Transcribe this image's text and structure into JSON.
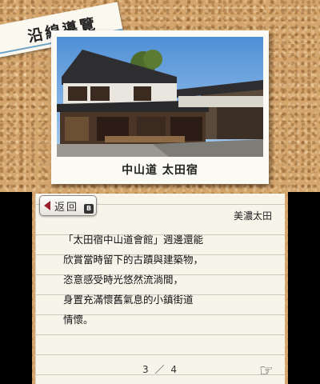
{
  "top": {
    "banner_title": "沿線導覽",
    "photo_caption": "中山道 太田宿"
  },
  "bottom": {
    "back_button": {
      "label": "返回",
      "key_hint": "B"
    },
    "location": "美濃太田",
    "lines": [
      "「太田宿中山道會館」週邊還能",
      "欣賞當時留下的古蹟與建築物，",
      "恣意感受時光悠然流淌間，",
      "身置充滿懷舊氣息的小鎮街道",
      "情懷。"
    ],
    "page": {
      "current": "3",
      "separator": "／",
      "total": "4"
    },
    "next_icon": "pointing-hand-icon"
  },
  "colors": {
    "cork": "#d4a56c",
    "paper": "#f7f4ea",
    "banner_stripe": "#6fa3c6",
    "back_arrow": "#9a2030"
  }
}
